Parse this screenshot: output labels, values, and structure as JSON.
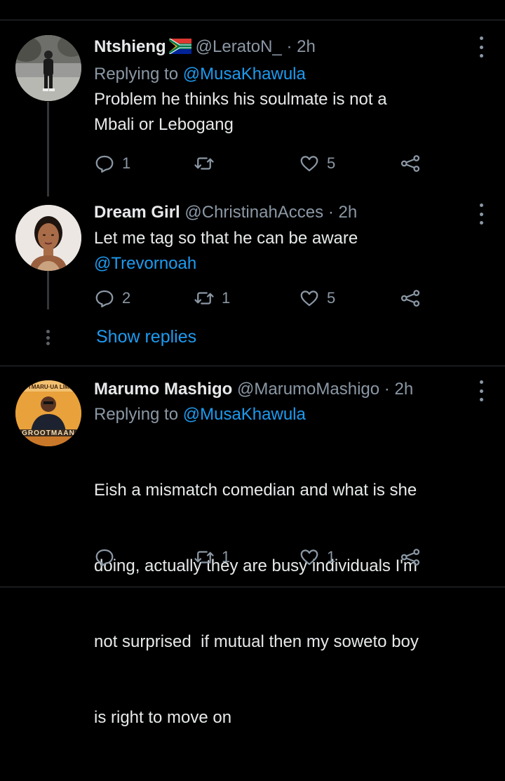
{
  "tweets": [
    {
      "name": "Ntshieng",
      "handle": "@LeratoN_",
      "dot": "·",
      "time": "2h",
      "replying_prefix": "Replying to",
      "replying_to": "@MusaKhawula",
      "text_line1": "Problem he thinks his soulmate is not a",
      "text_line2": "Mbali or Lebogang",
      "reply_count": "1",
      "retweet_count": "",
      "like_count": "5",
      "flag_icon": "south-africa-flag-icon"
    },
    {
      "name": "Dream Girl",
      "handle": "@ChristinahAcces",
      "dot": "·",
      "time": "2h",
      "text_line1": "Let me tag so that he can be aware",
      "mention": "@Trevornoah",
      "reply_count": "2",
      "retweet_count": "1",
      "like_count": "5"
    },
    {
      "name": "Marumo Mashigo",
      "handle": "@MarumoMashigo",
      "dot": "·",
      "time": "2h",
      "replying_prefix": "Replying to",
      "replying_to": "@MusaKhawula",
      "text_line1": "Eish a mismatch comedian and what is she",
      "text_line2": "doing, actually they are busy individuals I'm",
      "text_line3": "not surprised  if mutual then my soweto boy",
      "text_line4": "is right to move on",
      "reply_count": "",
      "retweet_count": "1",
      "like_count": "1",
      "avatar_text_top": "UTMARU·UA LIMP",
      "avatar_text_bottom": "GROOTMAAN"
    }
  ],
  "show_replies": "Show replies",
  "colors": {
    "background": "#000000",
    "text": "#e7e9ea",
    "secondary": "#8b98a5",
    "link": "#1d9bf0",
    "divider": "#2f3336"
  }
}
